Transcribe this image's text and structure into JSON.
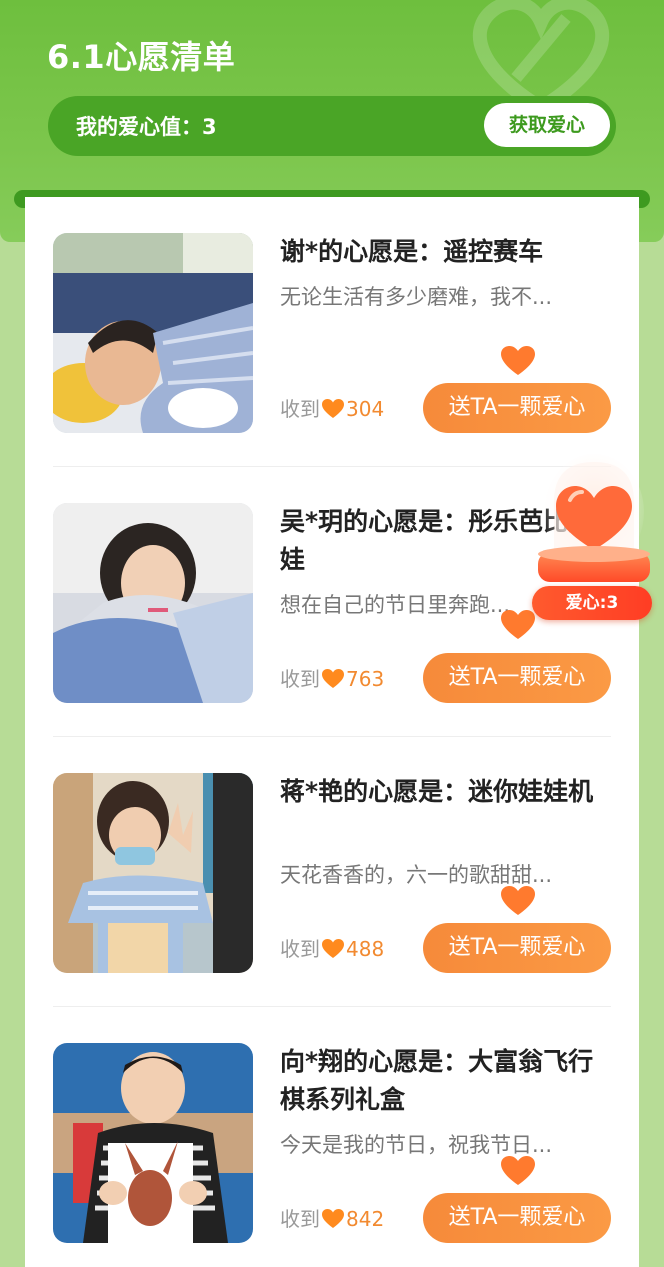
{
  "header": {
    "title": "6.1心愿清单",
    "love_value_label": "我的爱心值：3",
    "get_love_button": "获取爱心"
  },
  "wishes": [
    {
      "title": "谢*的心愿是：遥控赛车",
      "desc": "无论生活有多少磨难，我不...",
      "received_label": "收到",
      "count": "304",
      "button": "送TA一颗爱心"
    },
    {
      "title": "吴*玥的心愿是：彤乐芭比娃娃",
      "desc": "想在自己的节日里奔跑...",
      "received_label": "收到",
      "count": "763",
      "button": "送TA一颗爱心"
    },
    {
      "title": "蒋*艳的心愿是：迷你娃娃机",
      "desc": "天花香香的，六一的歌甜甜...",
      "received_label": "收到",
      "count": "488",
      "button": "送TA一颗爱心"
    },
    {
      "title": "向*翔的心愿是：大富翁飞行棋系列礼盒",
      "desc": "今天是我的节日，祝我节日...",
      "received_label": "收到",
      "count": "842",
      "button": "送TA一颗爱心"
    }
  ],
  "love_jar": {
    "label": "爱心:3"
  },
  "colors": {
    "header_green": "#6ebf3e",
    "bar_green": "#4aa526",
    "accent_orange": "#f68a3a",
    "jar_red": "#ff4a28"
  }
}
